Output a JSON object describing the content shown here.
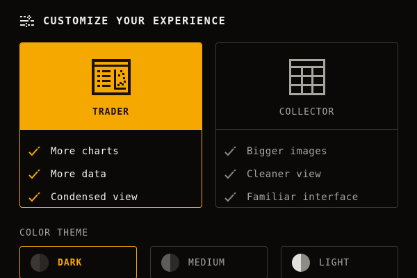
{
  "header": {
    "title": "CUSTOMIZE YOUR EXPERIENCE",
    "icon": "sliders-icon"
  },
  "modes": [
    {
      "title": "TRADER",
      "icon": "chart-table-icon",
      "selected": true,
      "features": [
        "More charts",
        "More data",
        "Condensed view"
      ]
    },
    {
      "title": "COLLECTOR",
      "icon": "grid-icon",
      "selected": false,
      "features": [
        "Bigger images",
        "Cleaner view",
        "Familiar interface"
      ]
    }
  ],
  "color_theme": {
    "label": "COLOR THEME",
    "options": [
      {
        "label": "DARK",
        "selected": true
      },
      {
        "label": "MEDIUM",
        "selected": false
      },
      {
        "label": "LIGHT",
        "selected": false
      }
    ]
  },
  "colors": {
    "accent": "#f5a800",
    "background": "#0b0908",
    "border": "#3a3836",
    "muted_text": "#a9a6a1"
  }
}
